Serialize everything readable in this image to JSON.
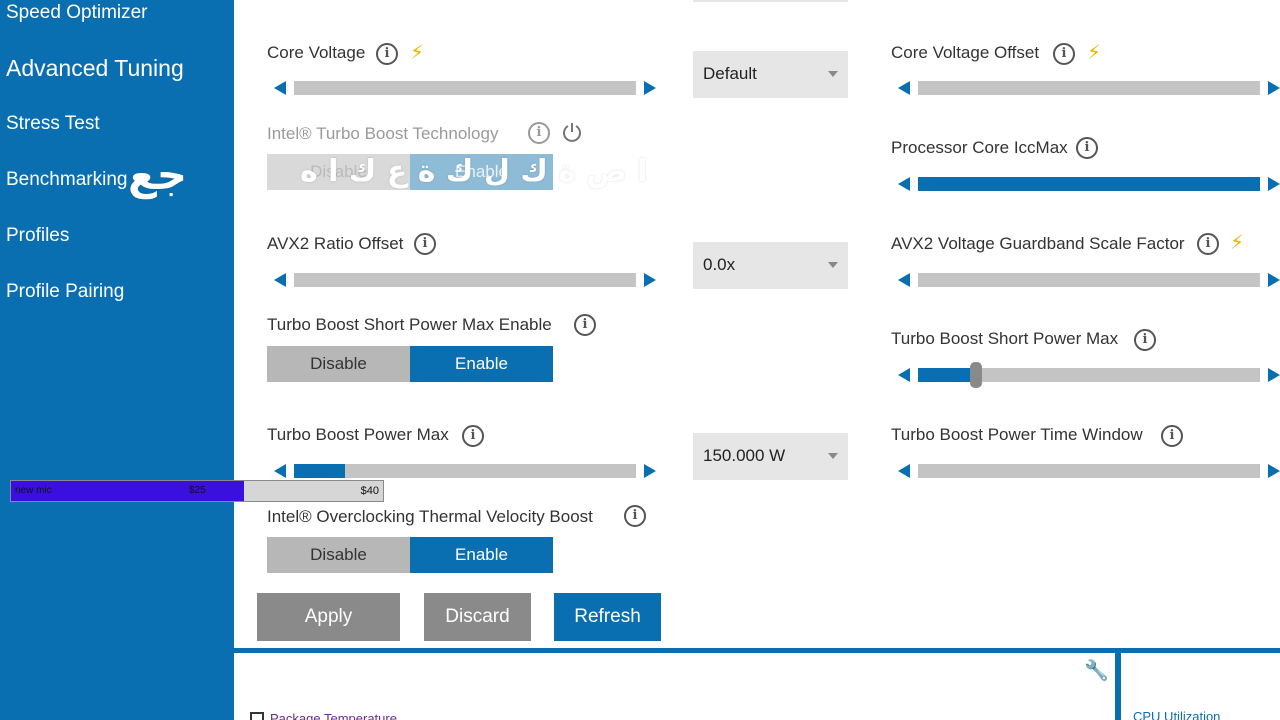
{
  "sidebar": {
    "items": [
      {
        "label": "Speed Optimizer"
      },
      {
        "label": "Advanced Tuning"
      },
      {
        "label": "Stress Test"
      },
      {
        "label": "Benchmarking"
      },
      {
        "label": "Profiles"
      },
      {
        "label": "Profile Pairing"
      }
    ]
  },
  "overlay": {
    "sidebar_text": "جع",
    "main_text": "ا ص ة ك ل ك ة ع ك ا ه"
  },
  "settings": {
    "core_voltage": {
      "label": "Core Voltage",
      "dropdown": "Default"
    },
    "core_voltage_offset": {
      "label": "Core Voltage Offset"
    },
    "turbo_boost_tech": {
      "label": "Intel® Turbo Boost Technology",
      "disable": "Disable",
      "enable": "Enable"
    },
    "processor_core_iccmax": {
      "label": "Processor Core IccMax"
    },
    "avx2_ratio_offset": {
      "label": "AVX2 Ratio Offset",
      "dropdown": "0.0x"
    },
    "avx2_voltage_guardband": {
      "label": "AVX2 Voltage Guardband Scale Factor"
    },
    "turbo_short_power_max_enable": {
      "label": "Turbo Boost Short Power Max Enable",
      "disable": "Disable",
      "enable": "Enable"
    },
    "turbo_short_power_max": {
      "label": "Turbo Boost Short Power Max",
      "level": 0.17
    },
    "turbo_power_max": {
      "label": "Turbo Boost Power Max",
      "dropdown": "150.000 W",
      "level": 0.15
    },
    "turbo_power_time_window": {
      "label": "Turbo Boost Power Time Window"
    },
    "ocvb": {
      "label": "Intel® Overclocking Thermal Velocity Boost",
      "disable": "Disable",
      "enable": "Enable"
    }
  },
  "buttons": {
    "apply": "Apply",
    "discard": "Discard",
    "refresh": "Refresh"
  },
  "donation": {
    "name": "new mic",
    "current": "$25",
    "goal": "$40",
    "progress": 0.625
  },
  "bottom": {
    "package_temperature": "Package Temperature",
    "cpu_utilization": "CPU Utilization"
  },
  "colors": {
    "accent": "#0a6fb0",
    "bolt": "#f0b400",
    "donation_fill": "#3a10e0"
  },
  "icons": [
    "info-icon",
    "lightning-icon",
    "power-icon",
    "wrench-icon",
    "dropdown-caret-icon",
    "arrow-left-icon",
    "arrow-right-icon"
  ]
}
